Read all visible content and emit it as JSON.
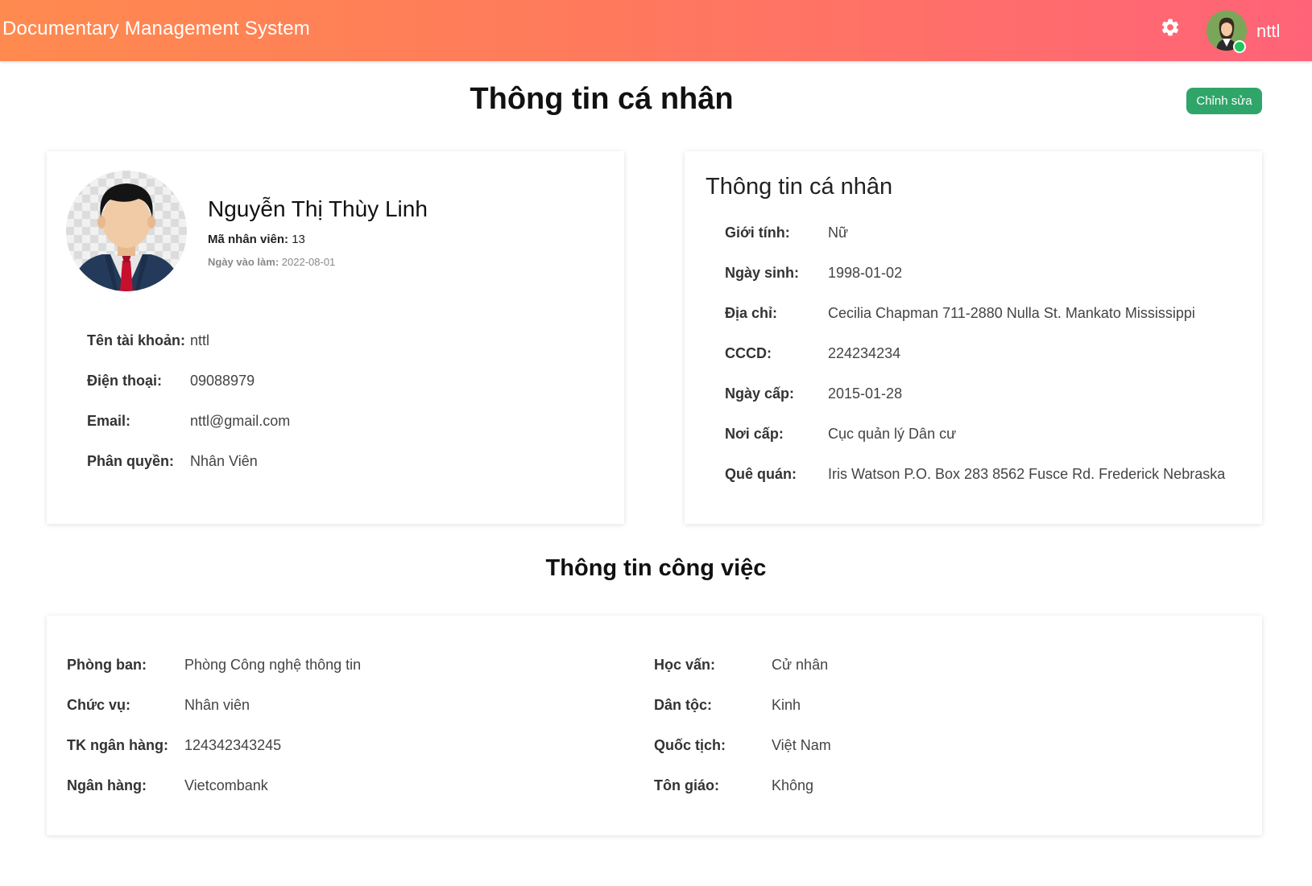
{
  "header": {
    "app_title": "Documentary Management System",
    "username": "nttl",
    "gear_icon": "gear-icon",
    "avatar_icon": "user-avatar-icon",
    "status": "online",
    "status_color": "#22c55e"
  },
  "page": {
    "title": "Thông tin cá nhân",
    "edit_label": "Chỉnh sửa",
    "edit_color": "#2fa56a"
  },
  "profile": {
    "full_name": "Nguyễn Thị Thùy Linh",
    "emp_id_label": "Mã nhân viên:",
    "emp_id": "13",
    "join_label": "Ngày vào làm:",
    "join_date": "2022-08-01",
    "account_label": "Tên tài khoản:",
    "account": "nttl",
    "phone_label": "Điện thoại:",
    "phone": "09088979",
    "email_label": "Email:",
    "email": "nttl@gmail.com",
    "role_label": "Phân quyền:",
    "role": "Nhân Viên"
  },
  "personal": {
    "heading": "Thông tin cá nhân",
    "rows": [
      {
        "label": "Giới tính:",
        "value": "Nữ"
      },
      {
        "label": "Ngày sinh:",
        "value": "1998-01-02"
      },
      {
        "label": "Địa chỉ:",
        "value": "Cecilia Chapman 711-2880 Nulla St. Mankato Mississippi"
      },
      {
        "label": "CCCD:",
        "value": "224234234"
      },
      {
        "label": "Ngày cấp:",
        "value": "2015-01-28"
      },
      {
        "label": "Nơi cấp:",
        "value": "Cục quản lý Dân cư"
      },
      {
        "label": "Quê quán:",
        "value": "Iris Watson P.O. Box 283 8562 Fusce Rd. Frederick Nebraska"
      }
    ]
  },
  "work": {
    "heading": "Thông tin công việc",
    "left": [
      {
        "label": "Phòng ban:",
        "value": "Phòng Công nghệ thông tin"
      },
      {
        "label": "Chức vụ:",
        "value": "Nhân viên"
      },
      {
        "label": "TK ngân hàng:",
        "value": "124342343245"
      },
      {
        "label": "Ngân hàng:",
        "value": "Vietcombank"
      }
    ],
    "right": [
      {
        "label": "Học vấn:",
        "value": "Cử nhân"
      },
      {
        "label": "Dân tộc:",
        "value": "Kinh"
      },
      {
        "label": "Quốc tịch:",
        "value": "Việt Nam"
      },
      {
        "label": "Tôn giáo:",
        "value": "Không"
      }
    ]
  }
}
